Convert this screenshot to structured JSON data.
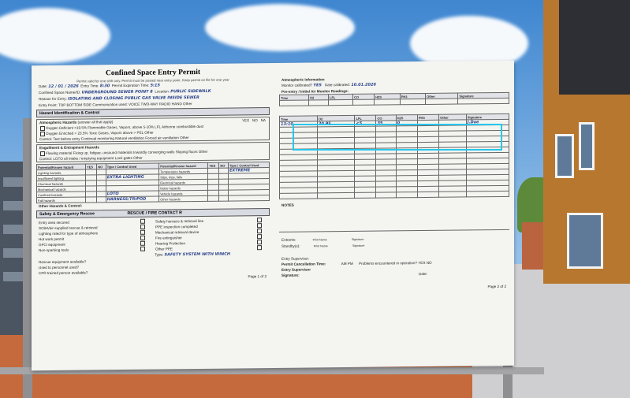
{
  "permit": {
    "title": "Confined Space Entry Permit",
    "subtitle": "Permit valid for one shift only. Permit must be posted near entry point. Keep permit on file for one year",
    "date_label": "Date:",
    "date_value": "12 / 01 / 2026",
    "entry_time_label": "Entry Time:",
    "entry_time_value": "8:30",
    "permit_expiry_label": "Permit Expiration Time:",
    "permit_expiry_value": "5:15",
    "space_name_label": "Confined Space Name/ID:",
    "space_name_value": "UNDERGROUND SEWER POINT 8",
    "location_label": "Location:",
    "location_value": "PUBLIC SIDEWALK",
    "reason_label": "Reason for Entry:",
    "reason_value": "ISOLATING AND CLOSING PUBLIC GAS VALVE INSIDE SEWER",
    "entry_point_label": "Entry Point:",
    "entry_point_options": "TOP  BOTTOM  SIDE   Communication used:  VOICE  TWO-WAY RADIO  HAND   Other",
    "hazard_section": "Hazard Identification & Control",
    "atm_heading": "Atmospheric Hazards",
    "atm_note": "(answer all that apply)",
    "atm_row1": "Oxygen Deficient <19.5%   Flammable Gases, Vapors, above 5-10% LFL   Airborne combustible dust",
    "atm_row2": "Oxygen Enriched > 23.5%   Toxic Gases, Vapors above > PEL   Other",
    "atm_control": "Control:  Test before entry   Continual monitoring   Natural ventilation   Forced air ventilation   Other",
    "eng_heading": "Engulfment & Entrapment Hazards",
    "eng_row": "Flowing material   Fixing up, fatigue, unsound materials   Inwardly converging walls   Sloping floors   Other",
    "eng_control": "Control:  LOTO all intake / emptying equipment   Lock gates   Other",
    "haz_table_headers": [
      "Potential/Known hazard",
      "YES",
      "NO",
      "Type / Control Used",
      "Potential/Known hazard",
      "YES",
      "NO",
      "Type / Control Used"
    ],
    "haz_rows": [
      [
        "Lighting hazards",
        "",
        "",
        "",
        "Temperature hazards",
        "",
        "",
        "EXTREME"
      ],
      [
        "Insufficient lighting",
        "",
        "",
        "EXTRA LIGHTING",
        "Slips, trips, falls",
        "",
        "",
        ""
      ],
      [
        "Chemical hazards",
        "",
        "",
        "",
        "Electrical hazards",
        "",
        "",
        ""
      ],
      [
        "Mechanical hazards",
        "",
        "",
        "",
        "Noise hazards",
        "",
        "",
        ""
      ],
      [
        "Confined hazards",
        "",
        "",
        "LOTO",
        "Vehicle hazards",
        "",
        "",
        ""
      ],
      [
        "Fall hazards",
        "",
        "",
        "HARNESS/TRIPOD",
        "Other hazards",
        "",
        "",
        ""
      ]
    ],
    "other_hazards_label": "Other Hazards & Control:",
    "safety_section": "Safety & Emergency Rescue",
    "rescue_heading": "RESCUE / FIRE CONTACT R",
    "yes": "YES",
    "no": "NO",
    "na": "NA",
    "rescue_rows": [
      "Entry area secured",
      "SCBA/air-supplied rescue & retrieval",
      "Lighting rated for type of atmosphere",
      "Hot work permit",
      "GFCI equipment",
      "Non-sparking tools"
    ],
    "rescue_rows_right": [
      "Safety harness & retrieval line",
      "PPE inspection completed",
      "Mechanical retrieval device",
      "Fire extinguisher",
      "Hearing Protection",
      "Other PPE"
    ],
    "ppe_type_label": "Type:",
    "ppe_type_value": "SAFETY SYSTEM WITH WINCH",
    "rescue_q1": "Rescue equipment available?",
    "rescue_q2": "Used to personnel used?",
    "rescue_q3": "CPR trained person available?",
    "page_no": "Page 1 of 2",
    "atmos_heading": "Atmospheric Information",
    "monitor_cal_label": "Monitor calibrated?",
    "monitor_cal_value": "YES",
    "cal_date_label": "Date calibrated:",
    "cal_date_value": "10.01.2026",
    "reading_table_headers": [
      "Time",
      "O2",
      "LFL",
      "CO",
      "H2S",
      "PH3",
      "Other",
      "Signature"
    ],
    "prereading_label": "Pre-entry / Initial Air Monitor Readings:",
    "reading_row": [
      "13:10",
      "20.95",
      "<5",
      "35",
      "0",
      "",
      "",
      "J.Doe"
    ],
    "notes_label": "NOTES",
    "entrants_label": "Entrants:",
    "standby_label": "Standby(s):",
    "print_name": "Print Name",
    "signature": "Signature",
    "entry_supervisor_label": "Entry Supervisor:",
    "cancel_time_label": "Permit Cancellation Time:",
    "cancel_am_pm": "AM  PM",
    "problems_label": "Problems encountered in operation?",
    "problems_yes": "YES",
    "problems_no": "NO",
    "entry_sup_sig_label": "Entry Supervisor",
    "signature_label": "Signature:",
    "date_label2": "Date:",
    "page_no_2": "Page 2 of 2"
  }
}
